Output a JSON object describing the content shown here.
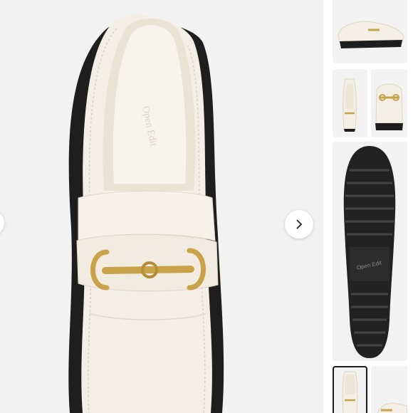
{
  "gallery": {
    "main_image": {
      "alt": "",
      "insole_brand": "Open Edit"
    },
    "next_button": {
      "icon": "chevron-right-icon"
    },
    "prev_button": {
      "icon": "chevron-left-icon"
    },
    "thumbnails": [
      {
        "view": "side",
        "selected": false
      },
      {
        "view": "top-angle",
        "selected": false
      },
      {
        "view": "front",
        "selected": false
      },
      {
        "view": "sole",
        "sole_brand": "Open Edit",
        "selected": false
      },
      {
        "view": "top-down",
        "selected": true
      },
      {
        "view": "detail",
        "selected": false
      }
    ]
  },
  "colors": {
    "background": "#f2f2f2",
    "leather": "#f3efe4",
    "sole": "#1e1e1e",
    "hardware": "#c9a24a"
  }
}
